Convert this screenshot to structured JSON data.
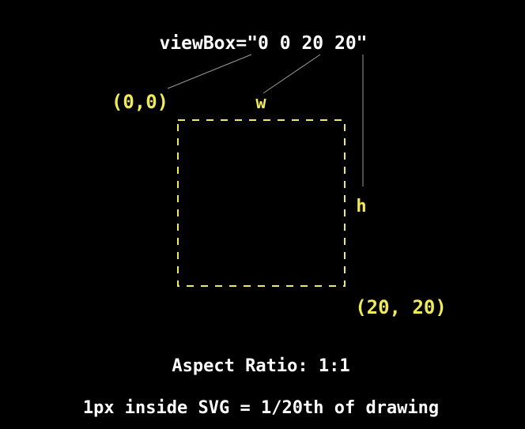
{
  "heading": "viewBox=\"0 0 20 20\"",
  "origin_label": "(0,0)",
  "width_label": "w",
  "height_label": "h",
  "corner_label": "(20, 20)",
  "aspect_ratio_text": "Aspect Ratio: 1:1",
  "scale_text": "1px inside SVG = 1/20th of drawing",
  "colors": {
    "background": "#000000",
    "heading_text": "#ffffff",
    "accent": "#f0e95a",
    "leader_lines": "#9a9a9a"
  }
}
